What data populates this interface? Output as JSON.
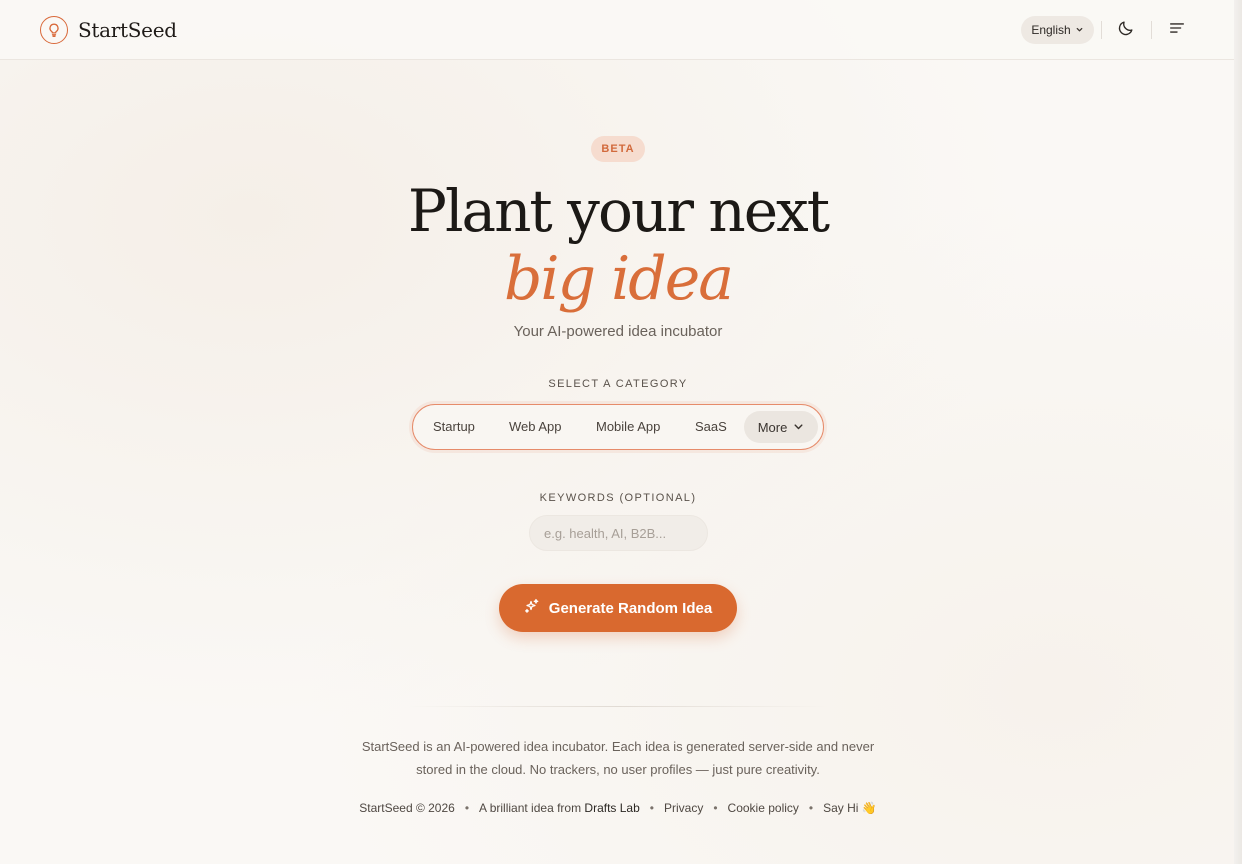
{
  "header": {
    "logo_text": "StartSeed",
    "language": "English",
    "icons": [
      "lightbulb-icon",
      "chevron-down-icon",
      "moon-icon",
      "menu-icon"
    ]
  },
  "hero": {
    "badge": "BETA",
    "title_line1": "Plant your next",
    "title_line2": "big idea",
    "tagline": "Your AI-powered idea incubator"
  },
  "category": {
    "label": "SELECT A CATEGORY",
    "items": [
      "Startup",
      "Web App",
      "Mobile App",
      "SaaS"
    ],
    "more_label": "More"
  },
  "keywords": {
    "label": "KEYWORDS (OPTIONAL)",
    "placeholder": "e.g. health, AI, B2B...",
    "value": ""
  },
  "generate": {
    "label": "Generate Random Idea"
  },
  "footer": {
    "description_line1": "StartSeed is an AI-powered idea incubator. Each idea is generated server-side and never",
    "description_line2": "stored in the cloud. No trackers, no user profiles — just pure creativity.",
    "copyright": "StartSeed © 2026",
    "credit_prefix": "A brilliant idea from ",
    "credit_name": "Drafts Lab",
    "privacy": "Privacy",
    "cookie": "Cookie policy",
    "say_hi": "Say Hi",
    "say_hi_emoji": "👋"
  },
  "colors": {
    "accent": "#d9692f",
    "accent_light": "#f6dccf",
    "background": "#faf8f5",
    "text_dark": "#1c1916"
  }
}
